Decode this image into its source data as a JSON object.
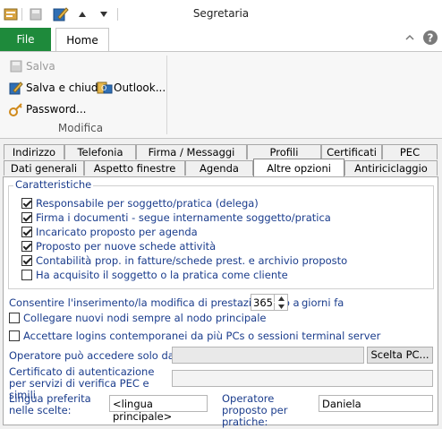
{
  "window": {
    "title": "Segretaria"
  },
  "qat": {
    "icons": [
      "app-icon",
      "save-icon",
      "edit-icon",
      "up-arrow-icon",
      "down-arrow-icon"
    ]
  },
  "ribbon": {
    "file_tab": "File",
    "home_tab": "Home",
    "collapse_icon": "chevron-up-icon",
    "help_icon": "help-icon",
    "buttons": {
      "salva": "Salva",
      "salva_chiudi": "Salva e chiudi",
      "outlook": "Outlook...",
      "password": "Password..."
    },
    "group_label": "Modifica"
  },
  "tabs": {
    "row1": [
      "Indirizzo",
      "Telefonia",
      "Firma / Messaggi",
      "Profili",
      "Certificati",
      "PEC"
    ],
    "row2": [
      "Dati generali",
      "Aspetto finestre",
      "Agenda",
      "Altre opzioni",
      "Antiriciclaggio"
    ],
    "active": "Altre opzioni"
  },
  "caratteristiche": {
    "legend": "Caratteristiche",
    "items": [
      {
        "label": "Responsabile per soggetto/pratica (delega)",
        "checked": true
      },
      {
        "label": "Firma i documenti - segue internamente soggetto/pratica",
        "checked": true
      },
      {
        "label": "Incaricato proposto per agenda",
        "checked": true
      },
      {
        "label": "Proposto per nuove schede attività",
        "checked": true
      },
      {
        "label": "Contabilità prop. in fatture/schede prest. e archivio proposto",
        "checked": true
      },
      {
        "label": "Ha acquisito il soggetto o la pratica come cliente",
        "checked": false
      }
    ]
  },
  "prestazioni": {
    "label_before": "Consentire l'inserimento/la modifica di prestazioni fino a",
    "value": "365",
    "label_after": "giorni fa"
  },
  "options": [
    {
      "label": "Collegare nuovi nodi sempre al nodo principale",
      "checked": false
    },
    {
      "label": "Accettare logins contemporanei da più PCs o sessioni terminal server",
      "checked": false
    }
  ],
  "pc": {
    "label": "Operatore può accedere solo dal PC:",
    "value": "",
    "button": "Scelta PC..."
  },
  "cert": {
    "label": "Certificato di autenticazione per servizi di verifica PEC e simili",
    "value": ""
  },
  "lingua": {
    "label": "Lingua preferita nelle scelte:",
    "value": "<lingua principale>"
  },
  "operatore": {
    "label": "Operatore proposto per pratiche:",
    "value": "Daniela"
  }
}
